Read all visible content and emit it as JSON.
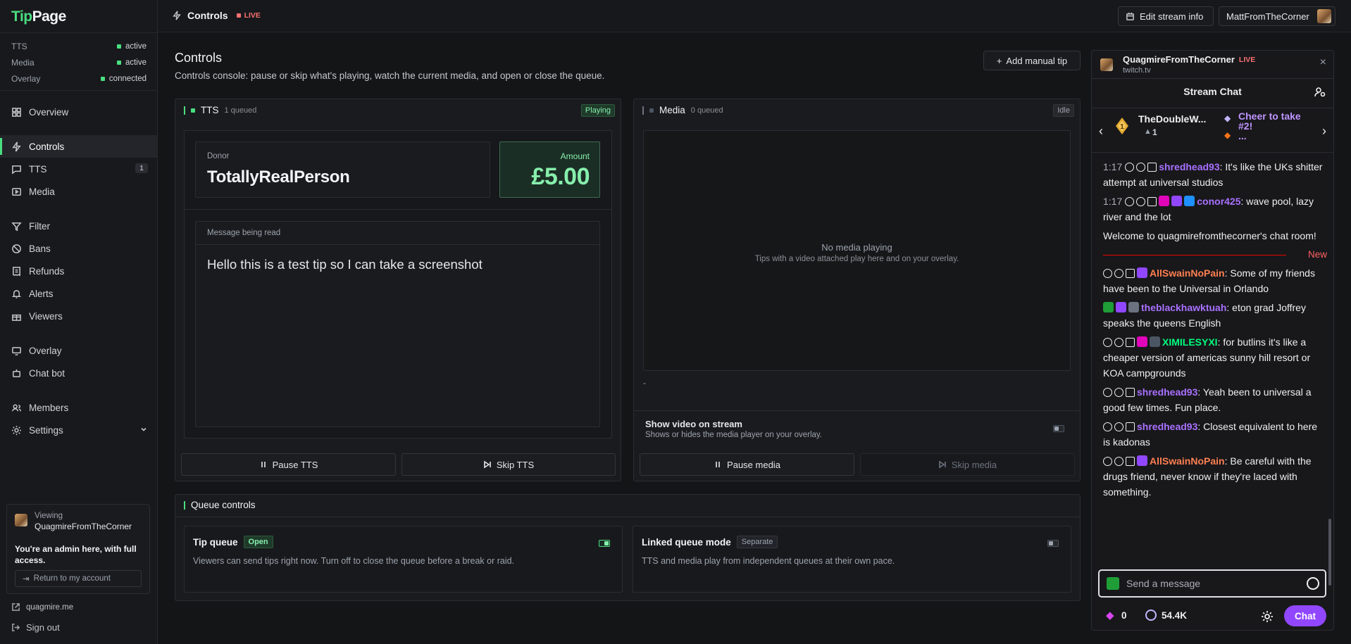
{
  "brand": {
    "part1": "Tip",
    "part2": "Page"
  },
  "status": [
    {
      "label": "TTS",
      "value": "active"
    },
    {
      "label": "Media",
      "value": "active"
    },
    {
      "label": "Overlay",
      "value": "connected"
    }
  ],
  "nav": {
    "overview": "Overview",
    "controls": "Controls",
    "tts": "TTS",
    "tts_badge": "1",
    "media": "Media",
    "filter": "Filter",
    "bans": "Bans",
    "refunds": "Refunds",
    "alerts": "Alerts",
    "viewers": "Viewers",
    "overlay": "Overlay",
    "chatbot": "Chat bot",
    "members": "Members",
    "settings": "Settings"
  },
  "viewing": {
    "label": "Viewing",
    "channel": "QuagmireFromTheCorner",
    "notice": "You're an admin here, with full access.",
    "return_btn": "Return to my account"
  },
  "sidebar_footer": {
    "site": "quagmire.me",
    "signout": "Sign out"
  },
  "topbar": {
    "title": "Controls",
    "live": "LIVE",
    "edit_stream": "Edit stream info",
    "user": "MattFromTheCorner"
  },
  "page": {
    "title": "Controls",
    "subtitle": "Controls console: pause or skip what's playing, watch the current media, and open or close the queue.",
    "add_tip": "Add manual tip"
  },
  "tts": {
    "title": "TTS",
    "queued": "1 queued",
    "state": "Playing",
    "donor_label": "Donor",
    "donor_name": "TotallyRealPerson",
    "amount_label": "Amount",
    "amount": "£5.00",
    "message_label": "Message being read",
    "message": "Hello this is a test tip so I can take a screenshot",
    "pause": "Pause TTS",
    "skip": "Skip TTS"
  },
  "media": {
    "title": "Media",
    "queued": "0 queued",
    "state": "Idle",
    "empty_title": "No media playing",
    "empty_sub": "Tips with a video attached play here and on your overlay.",
    "dash": "-",
    "show_video_title": "Show video on stream",
    "show_video_sub": "Shows or hides the media player on your overlay.",
    "show_video_on": false,
    "pause": "Pause media",
    "skip": "Skip media"
  },
  "queue": {
    "title": "Queue controls",
    "tip_queue": {
      "title": "Tip queue",
      "tag": "Open",
      "desc": "Viewers can send tips right now. Turn off to close the queue before a break or raid.",
      "on": true
    },
    "linked": {
      "title": "Linked queue mode",
      "tag": "Separate",
      "desc": "TTS and media play from independent queues at their own pace.",
      "on": false
    }
  },
  "chat": {
    "channel": "QuagmireFromTheCorner",
    "live": "LIVE",
    "platform": "twitch.tv",
    "title": "Stream Chat",
    "hype": {
      "name": "TheDoubleW...",
      "count": "1",
      "cheer": "Cheer to take #2!",
      "more": "..."
    },
    "messages": [
      {
        "time": "1:17",
        "user": "shredhead93",
        "color": "#a970ff",
        "text": ": It's like the UKs shitter attempt at universal studios"
      },
      {
        "time": "1:17",
        "user": "conor425",
        "color": "#a970ff",
        "text": ": wave pool, lazy river and the lot"
      }
    ],
    "welcome": "Welcome to quagmirefromthecorner's chat room!",
    "new_label": "New",
    "messages2": [
      {
        "user": "AllSwainNoPain",
        "color": "#ff7f50",
        "text": ": Some of my friends have been to the Universal in Orlando"
      },
      {
        "user": "theblackhawktuah",
        "color": "#a970ff",
        "text": ": eton grad Joffrey speaks the queens English"
      },
      {
        "user": "XIMILESYXI",
        "color": "#00ff7f",
        "text": ": for butlins it's like a cheaper version of americas sunny hill resort or KOA campgrounds"
      },
      {
        "user": "shredhead93",
        "color": "#a970ff",
        "text": ": Yeah been to universal a good few times. Fun place."
      },
      {
        "user": "shredhead93",
        "color": "#a970ff",
        "text": ": Closest equivalent to here is kadonas"
      },
      {
        "user": "AllSwainNoPain",
        "color": "#ff7f50",
        "text": ": Be careful with the drugs friend, never know if they're laced with something."
      }
    ],
    "input_placeholder": "Send a message",
    "bits": "0",
    "points": "54.4K",
    "send": "Chat"
  }
}
